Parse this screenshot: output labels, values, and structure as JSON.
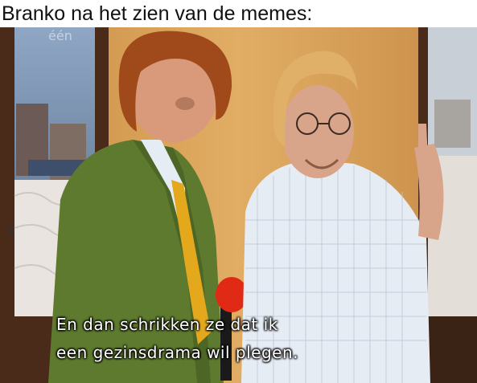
{
  "meme": {
    "caption": "Branko na het zien van de memes:",
    "subtitles": [
      "En dan schrikken ze dat ik",
      "een gezinsdrama wil plegen."
    ],
    "channel_logo": "één",
    "nav_glyph": "‹"
  },
  "colors": {
    "wall": "#d9a35a",
    "window_frame": "#4a2a18",
    "jacket": "#5e7a2e",
    "tie": "#e3a81c",
    "shirt": "#e6ecf4",
    "microphone": "#e02a16",
    "subtitle_text": "#ffffff"
  }
}
